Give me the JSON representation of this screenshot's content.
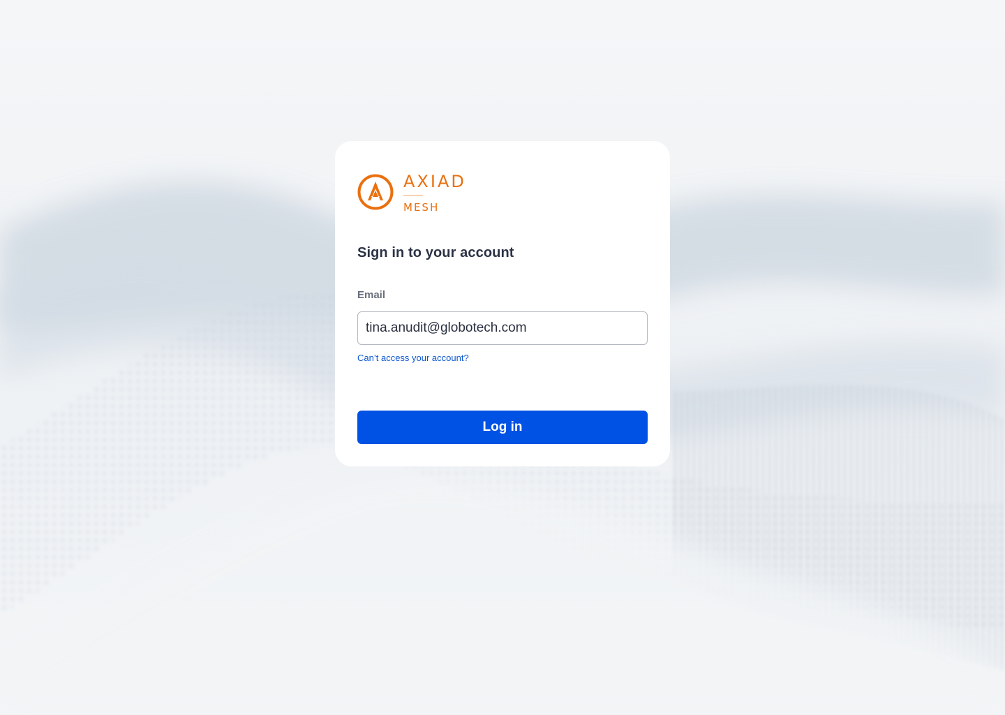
{
  "brand": {
    "name": "AXIAD",
    "product": "MESH",
    "color": "#ea700f",
    "logo_icon": "axiad-logo-icon"
  },
  "login": {
    "title": "Sign in to your account",
    "email_label": "Email",
    "email_value": "tina.anudit@globotech.com",
    "forgot_link": "Can’t access your account?",
    "submit_label": "Log in",
    "submit_color": "#0052e5",
    "link_color": "#0b57d0"
  }
}
